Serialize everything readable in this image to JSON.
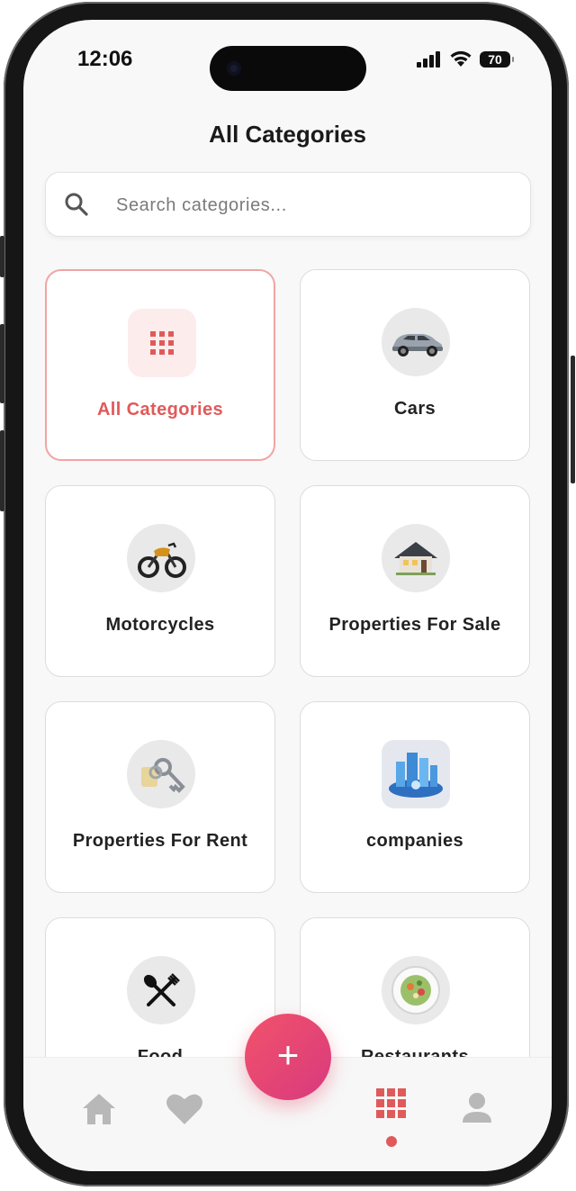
{
  "status_bar": {
    "time": "12:06",
    "battery": "70"
  },
  "page": {
    "title": "All Categories"
  },
  "search": {
    "placeholder": "Search categories..."
  },
  "categories": [
    {
      "label": "All Categories",
      "icon": "grid-icon",
      "selected": true
    },
    {
      "label": "Cars",
      "icon": "car-icon"
    },
    {
      "label": "Motorcycles",
      "icon": "motorcycle-icon"
    },
    {
      "label": "Properties For Sale",
      "icon": "house-icon"
    },
    {
      "label": "Properties For Rent",
      "icon": "keys-icon"
    },
    {
      "label": "companies",
      "icon": "city-buildings-icon"
    },
    {
      "label": "Food",
      "icon": "fork-knife-icon"
    },
    {
      "label": "Restaurants",
      "icon": "salad-plate-icon"
    }
  ],
  "bottom_nav": {
    "items": [
      {
        "icon": "home-icon"
      },
      {
        "icon": "heart-icon"
      },
      {
        "icon": "plus-icon"
      },
      {
        "icon": "grid-icon",
        "active": true
      },
      {
        "icon": "profile-icon"
      }
    ],
    "fab_label": "+"
  },
  "colors": {
    "accent": "#e05a5a",
    "fab_start": "#f2526a",
    "fab_end": "#d83a7e",
    "selected_border": "#f1a4a4"
  }
}
